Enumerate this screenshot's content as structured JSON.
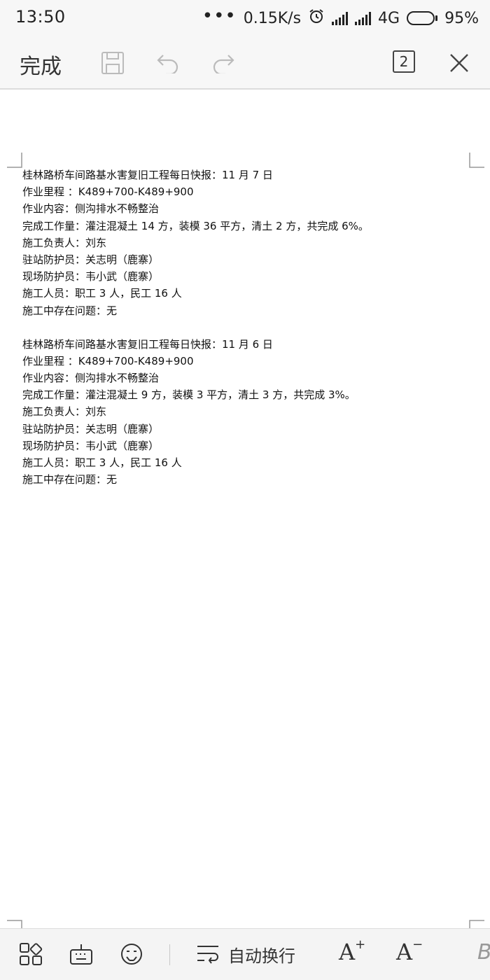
{
  "status_bar": {
    "time": "13:50",
    "speed": "0.15K/s",
    "network": "4G",
    "battery_percent": "95%",
    "battery_level": 0.95,
    "icons": [
      "more-dots-icon",
      "alarm-clock-icon",
      "signal-icon",
      "signal-icon",
      "battery-icon"
    ]
  },
  "toolbar": {
    "done_label": "完成",
    "page_count": "2",
    "icons": [
      "save-icon",
      "undo-icon",
      "redo-icon",
      "page-count-icon",
      "close-icon"
    ]
  },
  "document": {
    "reports": [
      {
        "lines": [
          "桂林路桥车间路基水害复旧工程每日快报：11 月 7 日",
          "作业里程 ：K489+700-K489+900",
          "作业内容：侧沟排水不畅整治",
          "完成工作量：灌注混凝土 14 方，装模 36 平方，清土 2 方，共完成 6%。",
          "施工负责人：刘东",
          "驻站防护员：关志明（鹿寨）",
          "现场防护员：韦小武（鹿寨）",
          "施工人员：职工 3 人，民工 16 人",
          "施工中存在问题：无"
        ]
      },
      {
        "lines": [
          "桂林路桥车间路基水害复旧工程每日快报：11 月 6 日",
          "作业里程 ：K489+700-K489+900",
          "作业内容：侧沟排水不畅整治",
          "完成工作量：灌注混凝土 9 方，装模 3 平方，清土 3 方，共完成 3%。",
          "施工负责人：刘东",
          "驻站防护员：关志明（鹿寨）",
          "现场防护员：韦小武（鹿寨）",
          "施工人员：职工 3 人，民工 16 人",
          "施工中存在问题：无"
        ]
      }
    ]
  },
  "bottom_bar": {
    "auto_wrap_label": "自动换行",
    "font_increase_label": "A",
    "font_decrease_label": "A",
    "bold_label": "B",
    "icons": [
      "apps-grid-icon",
      "keyboard-icon",
      "emoji-icon",
      "auto-wrap-icon",
      "font-increase-icon",
      "font-decrease-icon",
      "bold-icon"
    ]
  },
  "colors": {
    "bar_background": "#f7f7f7",
    "text": "#222222",
    "page": "#ffffff"
  }
}
